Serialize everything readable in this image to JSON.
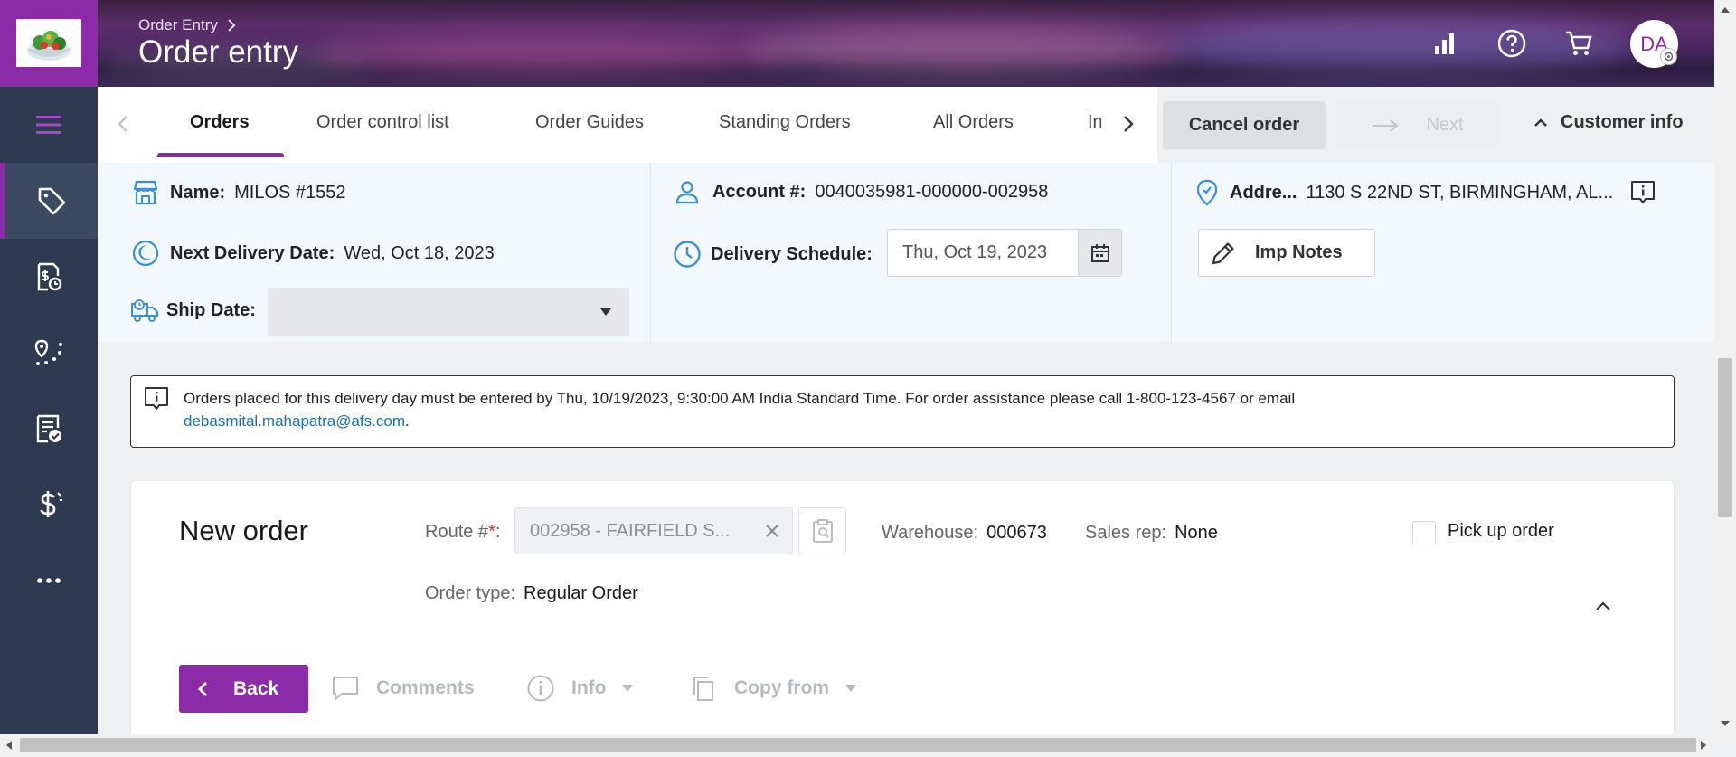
{
  "app": {
    "breadcrumb": "Order Entry",
    "title": "Order entry",
    "avatar_initials": "DA"
  },
  "header_icons": [
    "reports-icon",
    "help-icon",
    "cart-icon"
  ],
  "sidebar": {
    "items": [
      "menu-icon",
      "tag-icon",
      "invoice-icon",
      "route-icon",
      "checklist-icon",
      "dollar-icon",
      "more-icon"
    ],
    "active": "tag-icon"
  },
  "tabs": [
    {
      "label": "Orders",
      "active": true
    },
    {
      "label": "Order control list"
    },
    {
      "label": "Order Guides"
    },
    {
      "label": "Standing Orders"
    },
    {
      "label": "All Orders"
    },
    {
      "label": "In"
    }
  ],
  "actions": {
    "cancel": "Cancel order",
    "next": "Next",
    "customer_info": "Customer info"
  },
  "customer": {
    "name_label": "Name:",
    "name": "MILOS #1552",
    "account_label": "Account #:",
    "account": "0040035981-000000-002958",
    "address_label": "Addre...",
    "address": "1130 S 22ND ST, BIRMINGHAM, AL...",
    "next_delivery_label": "Next Delivery Date:",
    "next_delivery": "Wed, Oct 18, 2023",
    "delivery_schedule_label": "Delivery Schedule:",
    "delivery_schedule": "Thu, Oct 19, 2023",
    "ship_date_label": "Ship Date:",
    "ship_date": "",
    "imp_notes": "Imp Notes"
  },
  "notice": {
    "text": "Orders placed for this delivery day must be entered by Thu, 10/19/2023, 9:30:00 AM India Standard Time. For order assistance please call 1-800-123-4567 or email",
    "email": "debasmital.mahapatra@afs.com",
    "suffix": "."
  },
  "order": {
    "title": "New order",
    "route_label": "Route #",
    "required_mark": "*",
    "route_colon": ":",
    "route_value": "002958 - FAIRFIELD S...",
    "warehouse_label": "Warehouse:",
    "warehouse": "000673",
    "sales_rep_label": "Sales rep:",
    "sales_rep": "None",
    "pickup_label": "Pick up order",
    "order_type_label": "Order type:",
    "order_type": "Regular Order"
  },
  "toolbar": {
    "back": "Back",
    "comments": "Comments",
    "info": "Info",
    "copy_from": "Copy from"
  },
  "colors": {
    "brand": "#8c2ba8",
    "sidebar": "#2e3a4f",
    "panel": "#f3f8fc",
    "link": "#1a6fb5",
    "icon_blue": "#3b8fd9"
  }
}
